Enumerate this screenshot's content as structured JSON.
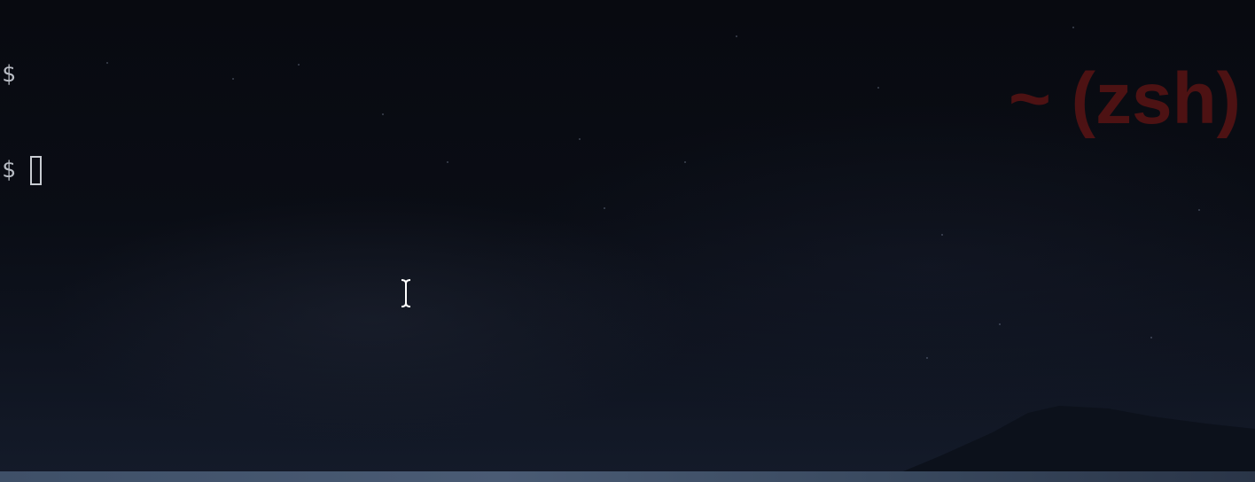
{
  "terminal": {
    "lines": [
      {
        "prompt": "$",
        "text": ""
      },
      {
        "prompt": "$",
        "text": ""
      }
    ],
    "tab_title": "~ (zsh)",
    "colors": {
      "background": "#07090f",
      "prompt_text": "#b8bcc4",
      "title_text": "#5a1414"
    },
    "icons": {
      "cursor": "block-cursor-icon",
      "mouse_pointer": "i-beam-cursor-icon"
    }
  }
}
